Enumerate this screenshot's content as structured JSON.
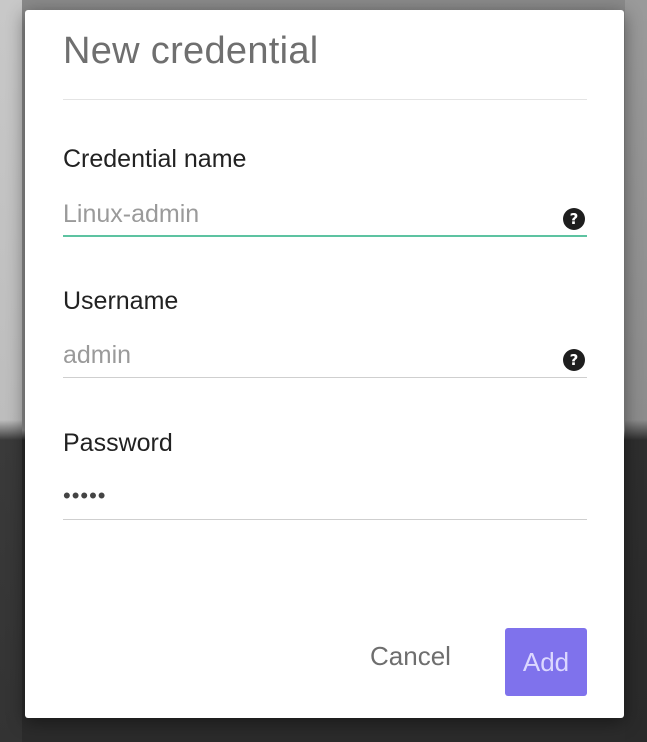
{
  "dialog": {
    "title": "New credential"
  },
  "form": {
    "credential_name": {
      "label": "Credential name",
      "value": "Linux-admin",
      "help_icon": "question-circle-icon"
    },
    "username": {
      "label": "Username",
      "value": "admin",
      "help_icon": "question-circle-icon"
    },
    "password": {
      "label": "Password",
      "value": "•••••"
    }
  },
  "actions": {
    "cancel_label": "Cancel",
    "add_label": "Add"
  },
  "colors": {
    "accent_purple": "#7f72ec",
    "active_underline": "#5dc3a1",
    "help_icon_bg": "#1e1e1e"
  }
}
